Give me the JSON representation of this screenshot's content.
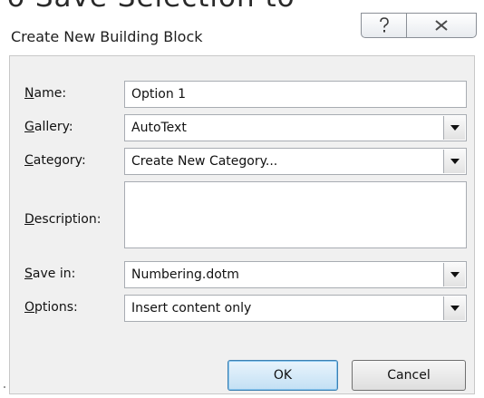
{
  "dialog": {
    "title": "Create New Building Block",
    "help_icon": "question-mark-icon",
    "close_icon": "close-x-icon"
  },
  "fields": {
    "name": {
      "label_key": "N",
      "label_rest": "ame:",
      "value": "Option 1"
    },
    "gallery": {
      "label_key": "G",
      "label_rest": "allery:",
      "value": "AutoText"
    },
    "category": {
      "label_key": "C",
      "label_rest": "ategory:",
      "value": "Create New Category..."
    },
    "description": {
      "label_key": "D",
      "label_rest": "escription:",
      "value": ""
    },
    "save_in": {
      "label_key": "S",
      "label_rest": "ave in:",
      "value": "Numbering.dotm"
    },
    "options": {
      "label_key": "O",
      "label_rest": "ptions:",
      "value": "Insert content only"
    }
  },
  "buttons": {
    "ok": "OK",
    "cancel": "Cancel"
  },
  "colors": {
    "ok_button_top": "#e9f4fc",
    "ok_button_bottom": "#c3e0f4",
    "panel_bg": "#f0f0f0"
  }
}
